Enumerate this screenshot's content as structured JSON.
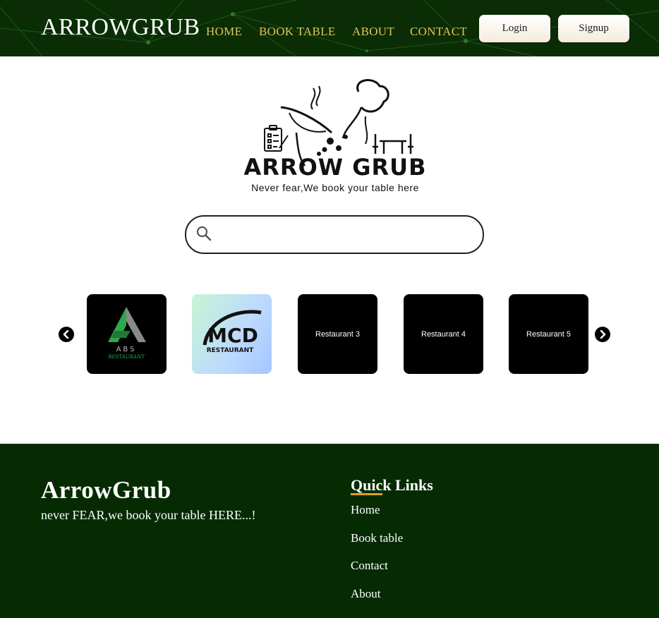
{
  "navbar": {
    "brand": "ARROWGRUB",
    "links": [
      "HOME",
      "BOOK TABLE",
      "ABOUT",
      "CONTACT"
    ],
    "login_label": "Login",
    "signup_label": "Signup"
  },
  "hero": {
    "logo_text": "ARROW GRUB",
    "tagline": "Never fear,We book your table here"
  },
  "search": {
    "placeholder": "",
    "value": ""
  },
  "carousel": {
    "cards": [
      {
        "name": "ABS",
        "sub": "RESTAURANT"
      },
      {
        "name": "MCD",
        "sub": "RESTAURANT"
      },
      {
        "label": "Restaurant 3"
      },
      {
        "label": "Restaurant 4"
      },
      {
        "label": "Restaurant 5"
      }
    ]
  },
  "footer": {
    "brand": "ArrowGrub",
    "tagline": "never FEAR,we book your table HERE...!",
    "quick_links_title": "Quick Links",
    "links": [
      "Home",
      "Book table",
      "Contact",
      "About"
    ]
  },
  "colors": {
    "nav_bg": "#0a2d06",
    "nav_link": "#e6c255",
    "footer_bg": "#062b03",
    "accent": "#e0a020"
  }
}
